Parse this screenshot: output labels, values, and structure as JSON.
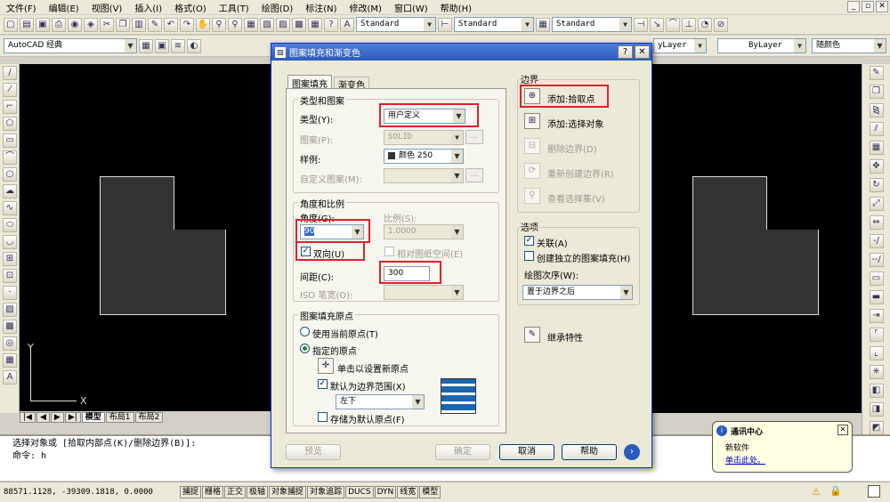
{
  "menu": [
    "文件(F)",
    "编辑(E)",
    "视图(V)",
    "插入(I)",
    "格式(O)",
    "工具(T)",
    "绘图(D)",
    "标注(N)",
    "修改(M)",
    "窗口(W)",
    "帮助(H)"
  ],
  "toolbar": {
    "text_style": "Standard",
    "dim_style": "Standard",
    "table_style": "Standard",
    "workspace": "AutoCAD 经典",
    "linetype": "ByLayer",
    "lineweight": "ByLayer",
    "plotstyle": "随颜色",
    "layer_tail": "yLayer"
  },
  "canvas": {
    "axis_y": "Y",
    "axis_x": "X"
  },
  "tabs": [
    "模型",
    "布局1",
    "布局2"
  ],
  "command": {
    "line1": "选择对象或 [拾取内部点(K)/删除边界(B)]:",
    "line2": "命令: h"
  },
  "status": {
    "coords": "88571.1128, -39309.1818, 0.0000",
    "buttons": [
      "捕捉",
      "栅格",
      "正交",
      "极轴",
      "对象捕捉",
      "对象追踪",
      "DUCS",
      "DYN",
      "线宽",
      "模型"
    ]
  },
  "dialog": {
    "title": "图案填充和渐变色",
    "tabs": [
      "图案填充",
      "渐变色"
    ],
    "type_group": "类型和图案",
    "type_label": "类型(Y):",
    "type_value": "用户定义",
    "pattern_label": "图案(P):",
    "pattern_value": "SOLID",
    "sample_label": "样例:",
    "sample_value": "颜色 250",
    "custom_label": "自定义图案(M):",
    "angle_group": "角度和比例",
    "angle_label": "角度(G):",
    "angle_value": "90",
    "scale_label": "比例(S):",
    "scale_value": "1.0000",
    "double_label": "双向(U)",
    "relative_label": "相对图纸空间(E)",
    "spacing_label": "间距(C):",
    "spacing_value": "300",
    "iso_label": "ISO 笔宽(O):",
    "origin_group": "图案填充原点",
    "use_current": "使用当前原点(T)",
    "specified": "指定的原点",
    "click_set": "单击以设置新原点",
    "default_boundary": "默认为边界范围(X)",
    "boundary_pos": "左下",
    "store_default": "存储为默认原点(F)",
    "border_group": "边界",
    "add_pick": "添加:拾取点",
    "add_select": "添加:选择对象",
    "remove_boundary": "删除边界(D)",
    "recreate_boundary": "重新创建边界(R)",
    "view_selection": "查看选择集(V)",
    "options_group": "选项",
    "associative": "关联(A)",
    "independent": "创建独立的图案填充(H)",
    "draw_order_label": "绘图次序(W):",
    "draw_order_value": "置于边界之后",
    "inherit": "继承特性",
    "preview": "预览",
    "ok": "确定",
    "cancel": "取消",
    "help": "帮助"
  },
  "balloon": {
    "title": "通讯中心",
    "text": "新软件",
    "link": "单击此处。"
  }
}
